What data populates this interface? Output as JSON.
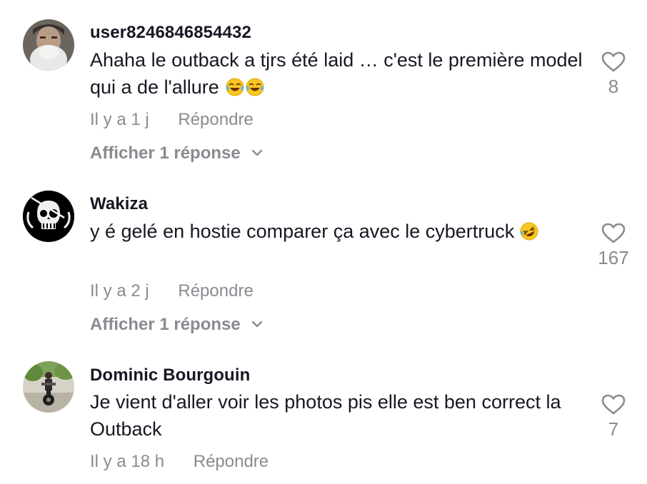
{
  "comments": [
    {
      "username": "user8246846854432",
      "text": "Ahaha le outback a tjrs été laid … c'est le première model qui a de l'allure",
      "emoji": "😂😂",
      "time": "Il y a 1 j",
      "reply_label": "Répondre",
      "view_replies": "Afficher 1 réponse",
      "likes": "8"
    },
    {
      "username": "Wakiza",
      "text": "y é gelé en hostie comparer ça avec le cybertruck",
      "emoji": "🤣",
      "time": "Il y a 2 j",
      "reply_label": "Répondre",
      "view_replies": "Afficher 1 réponse",
      "likes": "167"
    },
    {
      "username": "Dominic Bourgouin",
      "text": "Je vient d'aller voir les photos pis elle est ben correct la Outback",
      "time": "Il y a 18 h",
      "reply_label": "Répondre",
      "likes": "7"
    }
  ],
  "icons": {
    "like": "heart-outline-icon",
    "expand": "chevron-down-icon",
    "laugh_emoji": "face-with-tears-of-joy",
    "rofl_emoji": "rolling-on-floor-laughing"
  },
  "colors": {
    "primary_text": "#161823",
    "secondary_text": "#8a8b91",
    "background": "#ffffff"
  }
}
